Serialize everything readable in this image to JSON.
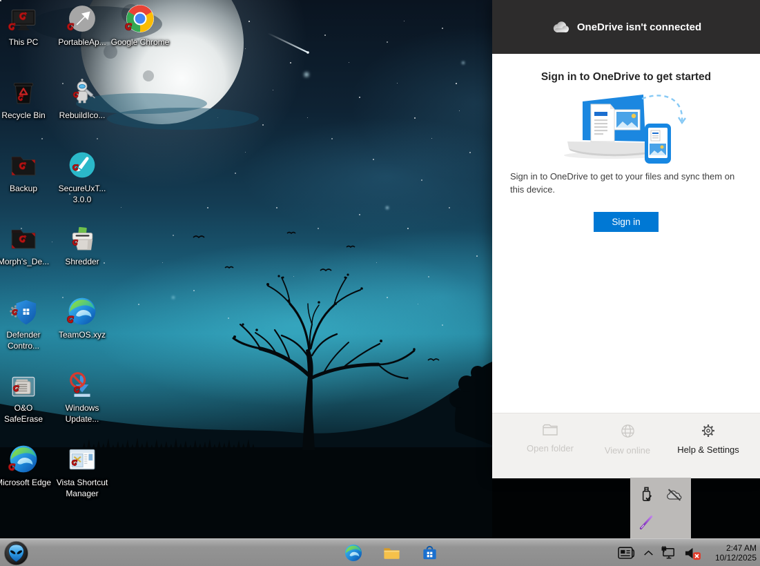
{
  "desktop": {
    "icons": [
      {
        "label": "This PC",
        "icon": "this-pc-icon"
      },
      {
        "label": "PortableAp...",
        "icon": "portableapps-icon"
      },
      {
        "label": "Google Chrome",
        "icon": "chrome-icon"
      },
      {
        "label": "Recycle Bin",
        "icon": "recycle-bin-icon"
      },
      {
        "label": "RebuildIco...",
        "icon": "rebuild-icons-robot-icon"
      },
      {
        "label": "Backup",
        "icon": "dark-folder-icon"
      },
      {
        "label": "SecureUxT... 3.0.0",
        "icon": "secureux-theme-icon"
      },
      {
        "label": "Morph's_De...",
        "icon": "dark-folder-icon"
      },
      {
        "label": "Shredder",
        "icon": "shredder-icon"
      },
      {
        "label": "Defender Contro...",
        "icon": "defender-shield-icon"
      },
      {
        "label": "TeamOS.xyz",
        "icon": "edge-icon"
      },
      {
        "label": "O&O SafeErase",
        "icon": "safeerase-machine-icon"
      },
      {
        "label": "Windows Update...",
        "icon": "windows-update-blocked-icon"
      },
      {
        "label": "Microsoft Edge",
        "icon": "edge-icon"
      },
      {
        "label": "Vista Shortcut Manager",
        "icon": "shortcut-manager-window-icon"
      }
    ]
  },
  "onedrive": {
    "header": {
      "title": "OneDrive isn't connected",
      "icon": "onedrive-cloud-icon"
    },
    "heading": "Sign in to OneDrive to get started",
    "description": "Sign in to OneDrive to get to your files and sync them on this device.",
    "sign_in_label": "Sign in",
    "accent_color": "#0078d4",
    "footer": {
      "items": [
        {
          "label": "Open folder",
          "icon": "folder-outline-icon",
          "disabled": true
        },
        {
          "label": "View online",
          "icon": "globe-icon",
          "disabled": true
        },
        {
          "label": "Help & Settings",
          "icon": "gear-icon",
          "disabled": false
        }
      ]
    }
  },
  "tray_popup": {
    "icons": [
      {
        "name": "usb-safely-remove-icon"
      },
      {
        "name": "onedrive-not-signed-in-icon"
      },
      {
        "name": "pen-icon"
      }
    ]
  },
  "taskbar": {
    "start_icon": "alienware-start-icon",
    "pinned": [
      {
        "name": "edge-icon"
      },
      {
        "name": "file-explorer-icon"
      },
      {
        "name": "microsoft-store-icon"
      }
    ],
    "tray_icons": [
      {
        "name": "news-icon"
      },
      {
        "name": "hidden-icons-chevron-icon"
      },
      {
        "name": "ethernet-network-icon"
      },
      {
        "name": "volume-muted-icon"
      }
    ],
    "clock": {
      "time": "2:47 AM",
      "date": "10/12/2025"
    }
  }
}
